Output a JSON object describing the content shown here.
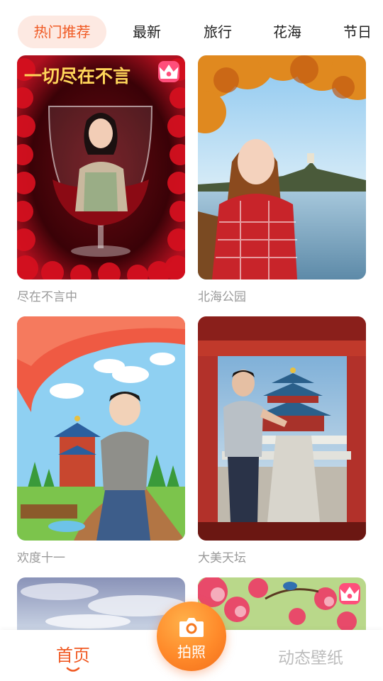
{
  "tabs": [
    {
      "label": "热门推荐",
      "active": true
    },
    {
      "label": "最新",
      "active": false
    },
    {
      "label": "旅行",
      "active": false
    },
    {
      "label": "花海",
      "active": false
    },
    {
      "label": "节日",
      "active": false
    }
  ],
  "cards": [
    {
      "title": "尽在不言中",
      "banner_text": "一切尽在不言",
      "vip": true
    },
    {
      "title": "北海公园",
      "vip": false
    },
    {
      "title": "欢度十一",
      "vip": false
    },
    {
      "title": "大美天坛",
      "vip": false
    },
    {
      "title": "",
      "vip": false
    },
    {
      "title": "",
      "vip": true
    }
  ],
  "bottom_nav": {
    "home_label": "首页",
    "camera_label": "拍照",
    "wallpaper_label": "动态壁纸"
  },
  "colors": {
    "accent": "#f05a24",
    "tab_active_bg": "#fde9e2",
    "vip_badge": "#ff4f7b",
    "camera_gradient_start": "#ffb14a",
    "camera_gradient_end": "#f26d1a",
    "muted_text": "#9a9a9a"
  },
  "icons": {
    "vip": "crown-icon",
    "camera": "camera-icon",
    "home_indicator": "smile-underline-icon"
  }
}
